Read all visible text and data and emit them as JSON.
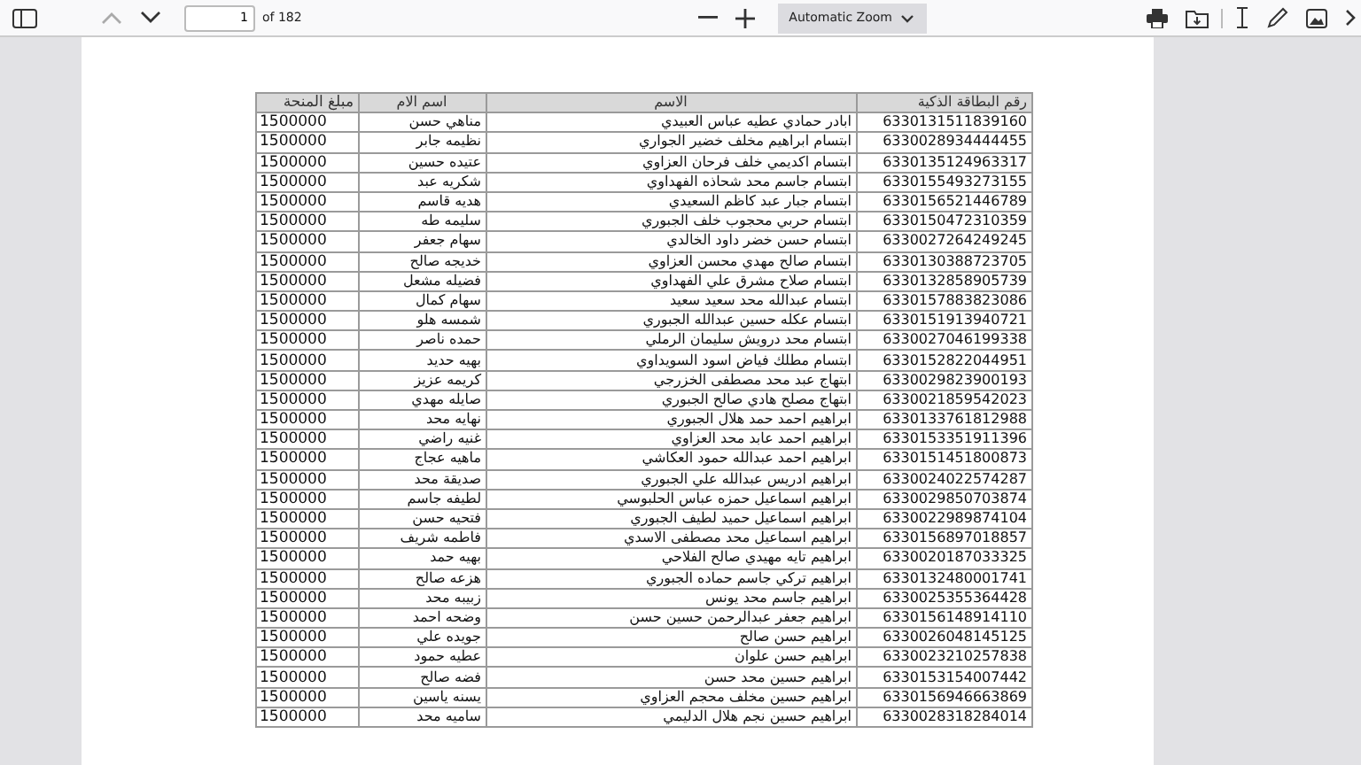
{
  "toolbar": {
    "page_number": "1",
    "page_count": "of 182",
    "zoom": "Automatic Zoom"
  },
  "table": {
    "columns": [
      "رقم البطاقة الذكية",
      "الاسم",
      "اسم الام",
      "مبلغ المنحة"
    ],
    "rows": [
      [
        "6330131511839160",
        "ابادر حمادي عطيه عباس العبيدي",
        "مناهي حسن",
        "1500000"
      ],
      [
        "6330028934444455",
        "ابتسام ابراهيم مخلف خضير الجواري",
        "نظيمه جابر",
        "1500000"
      ],
      [
        "6330135124963317",
        "ابتسام اكديمي خلف فرحان العزاوي",
        "عتيده حسين",
        "1500000"
      ],
      [
        "6330155493273155",
        "ابتسام جاسم محد شحاذه الفهداوي",
        "شكريه عبد",
        "1500000"
      ],
      [
        "6330156521446789",
        "ابتسام جبار عبد كاظم السعيدي",
        "هديه قاسم",
        "1500000"
      ],
      [
        "6330150472310359",
        "ابتسام حربي محجوب خلف الجبوري",
        "سليمه طه",
        "1500000"
      ],
      [
        "6330027264249245",
        "ابتسام حسن خضر داود الخالدي",
        "سهام جعفر",
        "1500000"
      ],
      [
        "6330130388723705",
        "ابتسام صالح مهدي محسن العزاوي",
        "خديجه صالح",
        "1500000"
      ],
      [
        "6330132858905739",
        "ابتسام صلاح مشرق علي الفهداوي",
        "فضيله مشعل",
        "1500000"
      ],
      [
        "6330157883823086",
        "ابتسام عبدالله محد سعيد سعيد",
        "سهام كمال",
        "1500000"
      ],
      [
        "6330151913940721",
        "ابتسام عكله حسين عبدالله الجبوري",
        "شمسه هلو",
        "1500000"
      ],
      [
        "6330027046199338",
        "ابتسام محد درويش سليمان الرملي",
        "حمده ناصر",
        "1500000"
      ],
      [
        "6330152822044951",
        "ابتسام مطلك فياض اسود السويداوي",
        "بهيه حديد",
        "1500000"
      ],
      [
        "6330029823900193",
        "ابتهاج عبد محد مصطفى الخزرجي",
        "كريمه عزيز",
        "1500000"
      ],
      [
        "6330021859542023",
        "ابتهاج مصلح هادي صالح الجبوري",
        "صايله مهدي",
        "1500000"
      ],
      [
        "6330133761812988",
        "ابراهيم احمد حمد هلال الجبوري",
        "نهايه محد",
        "1500000"
      ],
      [
        "6330153351911396",
        "ابراهيم احمد عابد محد العزاوي",
        "غنيه راضي",
        "1500000"
      ],
      [
        "6330151451800873",
        "ابراهيم احمد عبدالله حمود العكاشي",
        "ماهيه عجاج",
        "1500000"
      ],
      [
        "6330024022574287",
        "ابراهيم ادريس عبدالله علي الجبوري",
        "صديقة محد",
        "1500000"
      ],
      [
        "6330029850703874",
        "ابراهيم اسماعيل حمزه عباس الحلبوسي",
        "لطيفه جاسم",
        "1500000"
      ],
      [
        "6330022989874104",
        "ابراهيم اسماعيل حميد لطيف الجبوري",
        "فتحيه حسن",
        "1500000"
      ],
      [
        "6330156897018857",
        "ابراهيم اسماعيل محد مصطفى الاسدي",
        "فاطمه شريف",
        "1500000"
      ],
      [
        "6330020187033325",
        "ابراهيم تايه مهيدي صالح الفلاحي",
        "بهيه حمد",
        "1500000"
      ],
      [
        "6330132480001741",
        "ابراهيم تركي جاسم حماده الجبوري",
        "هزعه صالح",
        "1500000"
      ],
      [
        "6330025355364428",
        "ابراهيم جاسم محد يونس",
        "زبيبه محد",
        "1500000"
      ],
      [
        "6330156148914110",
        "ابراهيم جعفر عبدالرحمن حسين حسن",
        "وضحه احمد",
        "1500000"
      ],
      [
        "6330026048145125",
        "ابراهيم حسن صالح",
        "جويده علي",
        "1500000"
      ],
      [
        "6330023210257838",
        "ابراهيم حسن علوان",
        "عطيه حمود",
        "1500000"
      ],
      [
        "6330153154007442",
        "ابراهيم حسين محد حسن",
        "فضه صالح",
        "1500000"
      ],
      [
        "6330156946663869",
        "ابراهيم حسين مخلف محجم العزاوي",
        "يسنه ياسين",
        "1500000"
      ],
      [
        "6330028318284014",
        "ابراهيم حسين نجم هلال الدليمي",
        "ساميه محد",
        "1500000"
      ]
    ]
  }
}
